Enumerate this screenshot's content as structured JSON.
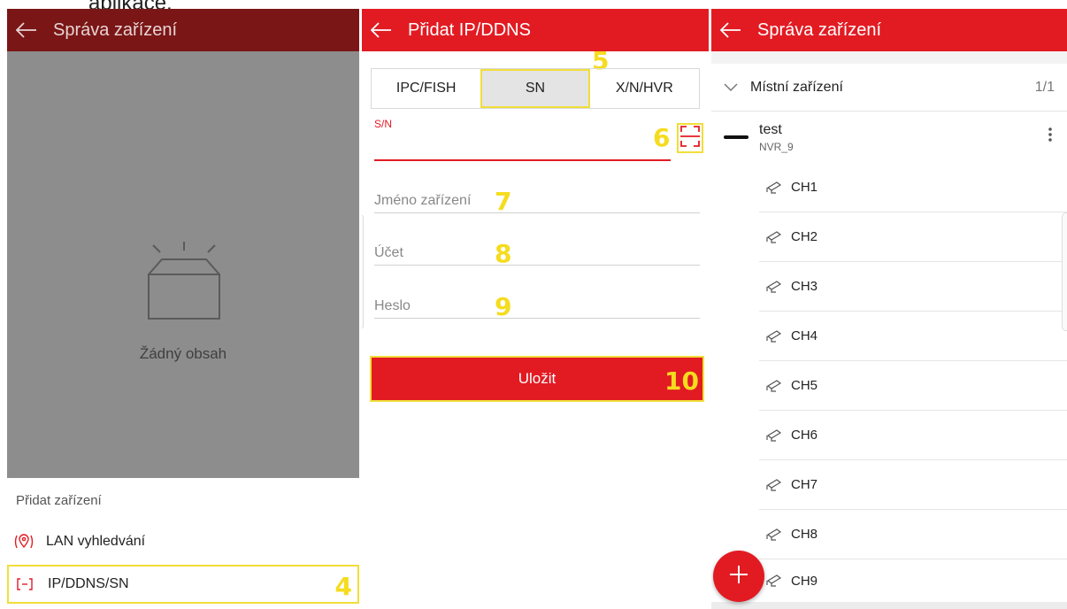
{
  "caption": "aplikace.",
  "panel_manage": {
    "title": "Správa zařízení",
    "empty_text": "Žádný obsah",
    "sheet_title": "Přidat zařízení",
    "lan_label": "LAN vyhledvání",
    "ip_label": "IP/DDNS/SN",
    "marker": "4"
  },
  "panel_add": {
    "title": "Přidat IP/DDNS",
    "tabs": [
      "IPC/FISH",
      "SN",
      "X/N/HVR"
    ],
    "active_tab": "SN",
    "sn_label": "S/N",
    "name_placeholder": "Jméno zařízení",
    "account_placeholder": "Účet",
    "password_placeholder": "Heslo",
    "save_label": "Uložit",
    "markers": {
      "tab": "5",
      "scan": "6",
      "name": "7",
      "account": "8",
      "password": "9",
      "save": "10"
    }
  },
  "panel_list": {
    "title": "Správa zařízení",
    "group_label": "Místní zařízení",
    "group_count": "1/1",
    "device_name": "test",
    "device_sub": "NVR_9",
    "channels": [
      "CH1",
      "CH2",
      "CH3",
      "CH4",
      "CH5",
      "CH6",
      "CH7",
      "CH8",
      "CH9"
    ]
  },
  "colors": {
    "accent": "#e21b23",
    "highlight": "#f2de3a",
    "dim_bar": "#7a1616"
  },
  "icons": [
    "back-arrow-icon",
    "empty-box-icon",
    "location-pin-icon",
    "ip-device-icon",
    "scan-icon",
    "chevron-down-icon",
    "more-vertical-icon",
    "camera-icon",
    "plus-icon"
  ]
}
